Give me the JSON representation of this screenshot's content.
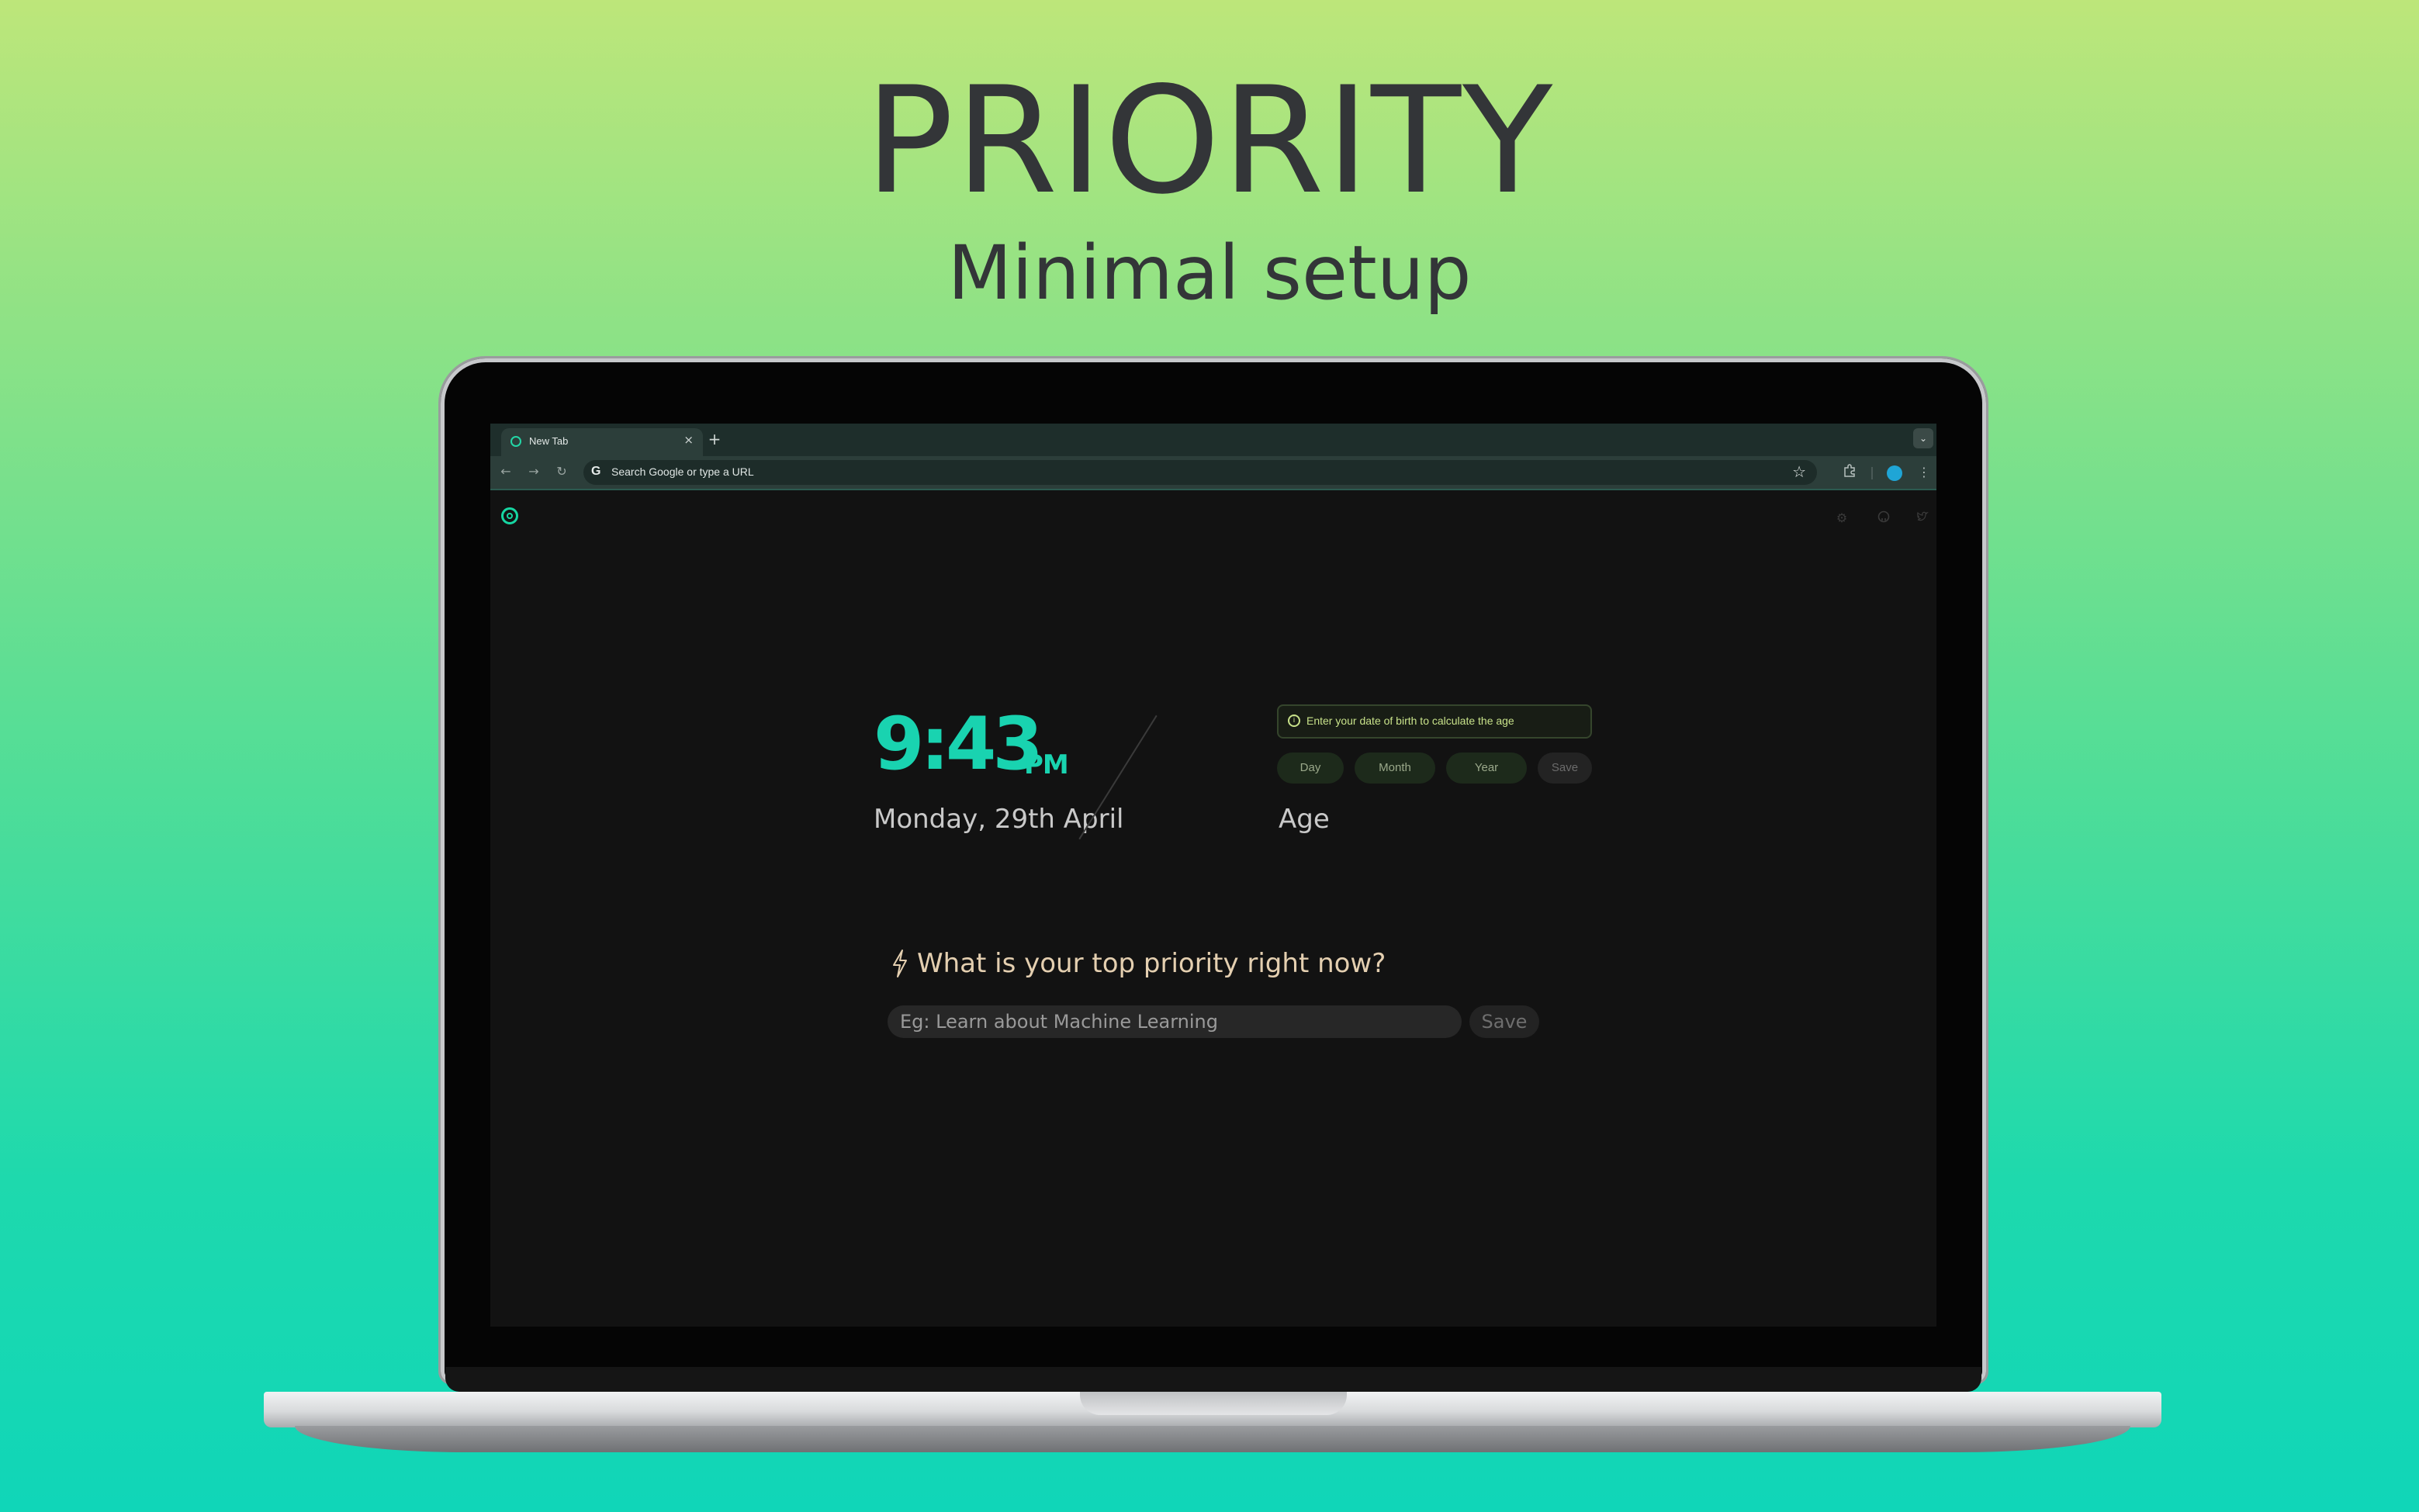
{
  "hero": {
    "title": "PRIORITY",
    "subtitle": "Minimal setup"
  },
  "browser": {
    "tab_title": "New Tab",
    "tab_close": "×",
    "new_tab": "+",
    "omnibox_icon": "G",
    "omnibox_text": "Search Google or type a URL",
    "icons": {
      "back": "back-arrow-icon",
      "forward": "forward-arrow-icon",
      "reload": "reload-icon",
      "star": "star-icon",
      "extensions": "puzzle-icon",
      "menu": "kebab-menu-icon",
      "tab_menu": "chevron-down-icon"
    }
  },
  "page": {
    "logo": "priority-logo-icon",
    "top_icons": [
      "settings-icon",
      "github-icon",
      "twitter-icon"
    ],
    "clock": {
      "time": "9:43",
      "ampm": "PM",
      "date": "Monday, 29th April"
    },
    "age": {
      "info_text": "Enter your date of birth to calculate the age",
      "info_icon": "i",
      "buttons": {
        "day": "Day",
        "month": "Month",
        "year": "Year",
        "save": "Save"
      },
      "label": "Age"
    },
    "priority": {
      "question": "What is your top priority right now?",
      "placeholder": "Eg: Learn about Machine Learning",
      "save": "Save"
    }
  },
  "colors": {
    "accent": "#19d3b0",
    "info": "#c8e28a",
    "priority_text": "#e4cfb0"
  }
}
